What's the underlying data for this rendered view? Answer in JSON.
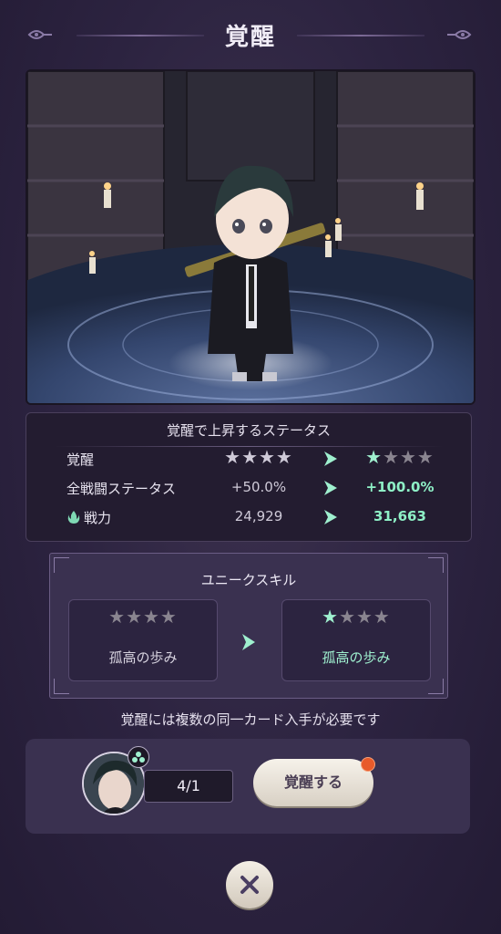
{
  "header": {
    "title": "覚醒"
  },
  "stats": {
    "title": "覚醒で上昇するステータス",
    "rows": [
      {
        "label": "覚醒",
        "current": "★★★★",
        "next_on": "★",
        "next_off": "★★★"
      },
      {
        "label": "全戦闘ステータス",
        "current": "+50.0%",
        "next": "+100.0%"
      },
      {
        "label": "戦力",
        "current": "24,929",
        "next": "31,663"
      }
    ]
  },
  "skill": {
    "title": "ユニークスキル",
    "before": {
      "stars": "★★★★",
      "name": "孤高の歩み"
    },
    "after": {
      "stars_on": "★",
      "stars_off": "★★★",
      "name": "孤高の歩み"
    }
  },
  "notice": "覚醒には複数の同一カード入手が必要です",
  "card": {
    "count": "4/1"
  },
  "buttons": {
    "awaken": "覚醒する"
  },
  "colors": {
    "accent": "#9ff0cf",
    "badge": "#e85a2a",
    "panel": "#3a3150"
  }
}
